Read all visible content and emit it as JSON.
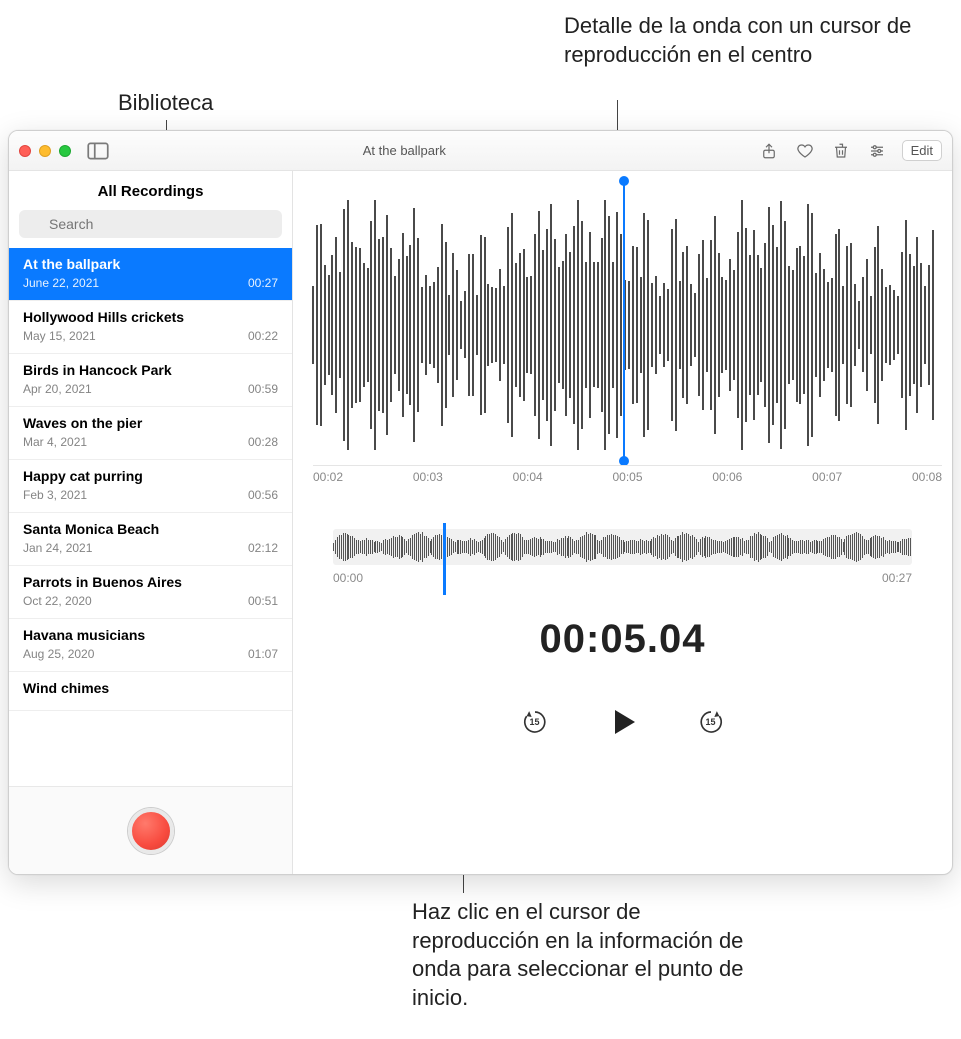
{
  "callouts": {
    "top_right": "Detalle de la onda con un cursor de reproducción en el centro",
    "top_left": "Biblioteca",
    "bottom": "Haz clic en el cursor de reproducción en la información de onda para seleccionar el punto de inicio."
  },
  "titlebar": {
    "title": "At the ballpark",
    "edit_label": "Edit"
  },
  "sidebar": {
    "header": "All Recordings",
    "search_placeholder": "Search",
    "items": [
      {
        "title": "At the ballpark",
        "date": "June 22, 2021",
        "duration": "00:27",
        "selected": true
      },
      {
        "title": "Hollywood Hills crickets",
        "date": "May 15, 2021",
        "duration": "00:22"
      },
      {
        "title": "Birds in Hancock Park",
        "date": "Apr 20, 2021",
        "duration": "00:59"
      },
      {
        "title": "Waves on the pier",
        "date": "Mar 4, 2021",
        "duration": "00:28"
      },
      {
        "title": "Happy cat purring",
        "date": "Feb 3, 2021",
        "duration": "00:56"
      },
      {
        "title": "Santa Monica Beach",
        "date": "Jan 24, 2021",
        "duration": "02:12"
      },
      {
        "title": "Parrots in Buenos Aires",
        "date": "Oct 22, 2020",
        "duration": "00:51"
      },
      {
        "title": "Havana musicians",
        "date": "Aug 25, 2020",
        "duration": "01:07"
      },
      {
        "title": "Wind chimes",
        "date": "",
        "duration": ""
      }
    ]
  },
  "detail": {
    "ticks": [
      "00:02",
      "00:03",
      "00:04",
      "00:05",
      "00:06",
      "00:07",
      "00:08"
    ]
  },
  "overview": {
    "start": "00:00",
    "end": "00:27"
  },
  "timecode": "00:05.04",
  "transport": {
    "skip_back": "15",
    "skip_fwd": "15"
  }
}
